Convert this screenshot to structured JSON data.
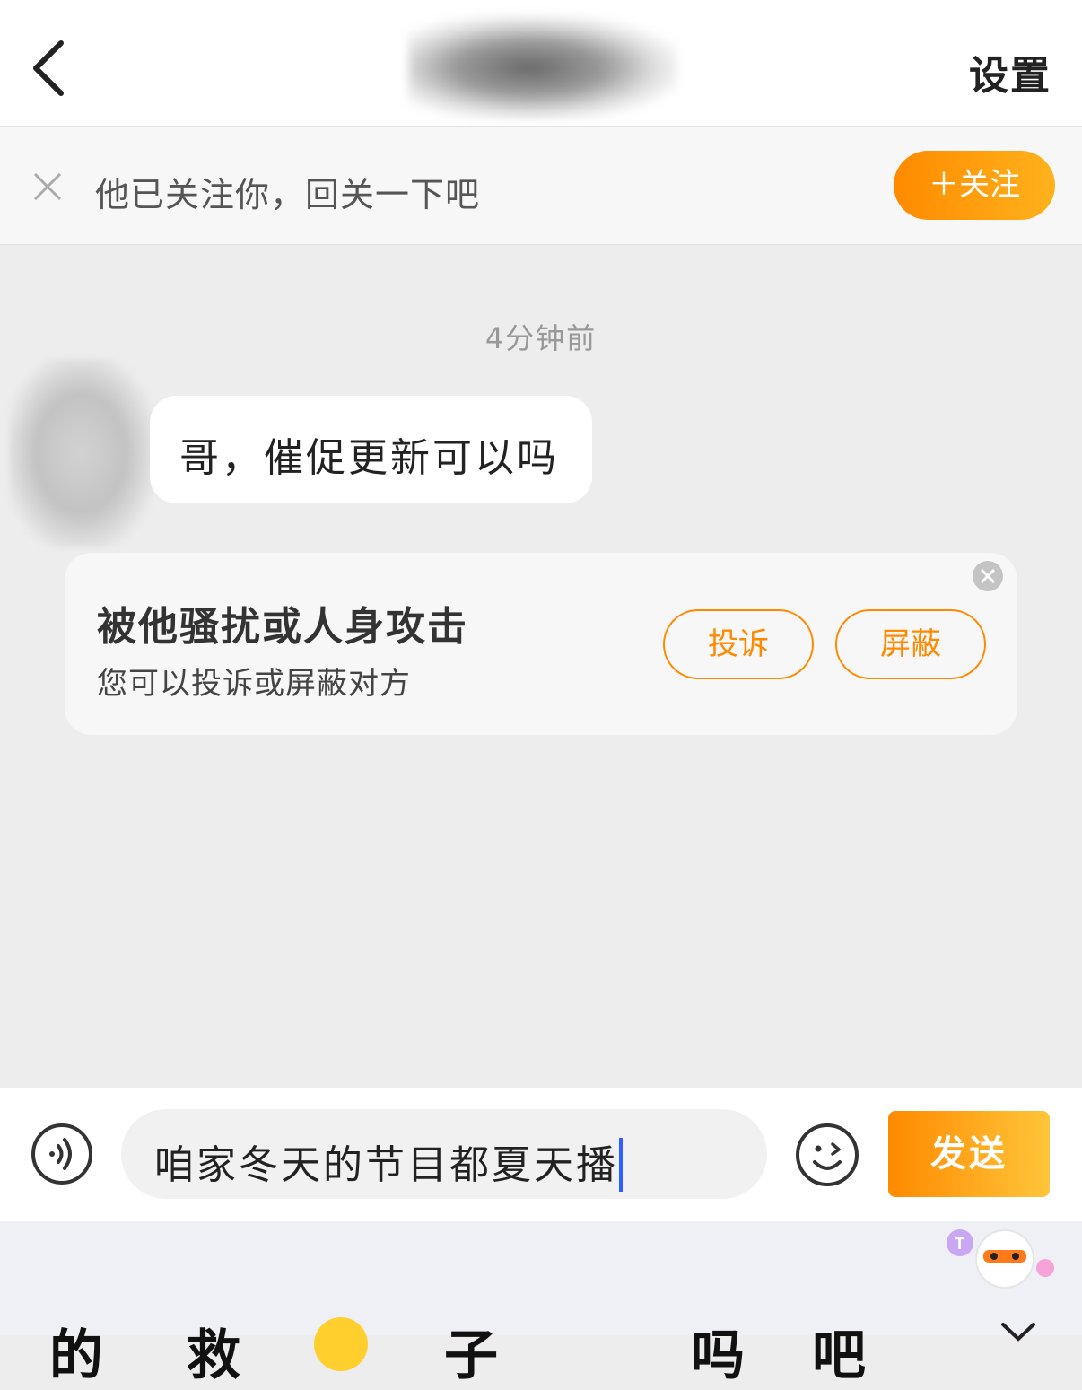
{
  "header": {
    "back_icon": "chevron-left-icon",
    "settings_label": "设置"
  },
  "follow_banner": {
    "close_icon": "close-icon",
    "text": "他已关注你，回关一下吧",
    "follow_button": "＋关注"
  },
  "chat": {
    "timestamp": "4分钟前",
    "messages": [
      {
        "from": "other",
        "text": "哥，催促更新可以吗"
      }
    ]
  },
  "harassment_card": {
    "title": "被他骚扰或人身攻击",
    "subtitle": "您可以投诉或屏蔽对方",
    "report_label": "投诉",
    "block_label": "屏蔽",
    "close_icon": "close-circle-icon"
  },
  "composer": {
    "voice_icon": "voice-icon",
    "input_value": "咱家冬天的节目都夏天播",
    "emoji_icon": "emoji-icon",
    "send_label": "发送"
  },
  "keyboard": {
    "candidates": [
      "的",
      "救",
      "子",
      "吗",
      "吧"
    ]
  },
  "colors": {
    "accent": "#ff8a00",
    "accent_light": "#ffb21c",
    "chat_background": "#ededed",
    "caret": "#2f5fff"
  }
}
